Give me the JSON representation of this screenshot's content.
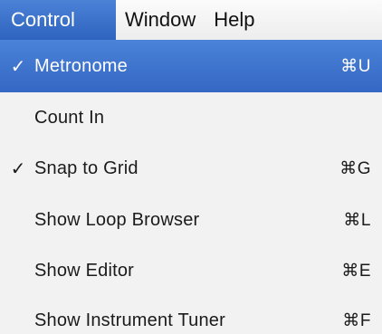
{
  "menubar": {
    "items": [
      {
        "label": "Control",
        "active": true
      },
      {
        "label": "Window",
        "active": false
      },
      {
        "label": "Help",
        "active": false
      }
    ]
  },
  "dropdown": {
    "items": [
      {
        "label": "Metronome",
        "checked": true,
        "check_glyph": "✓",
        "shortcut": "⌘U",
        "selected": true
      },
      {
        "label": "Count In",
        "checked": false,
        "check_glyph": "",
        "shortcut": "",
        "selected": false
      },
      {
        "label": "Snap to Grid",
        "checked": true,
        "check_glyph": "✓",
        "shortcut": "⌘G",
        "selected": false
      },
      {
        "label": "Show Loop Browser",
        "checked": false,
        "check_glyph": "",
        "shortcut": "⌘L",
        "selected": false
      },
      {
        "label": "Show Editor",
        "checked": false,
        "check_glyph": "",
        "shortcut": "⌘E",
        "selected": false
      },
      {
        "label": "Show Instrument Tuner",
        "checked": false,
        "check_glyph": "",
        "shortcut": "⌘F",
        "selected": false
      }
    ]
  },
  "colors": {
    "selection": "#3d72cf",
    "menu_background": "#f2f2f2"
  }
}
